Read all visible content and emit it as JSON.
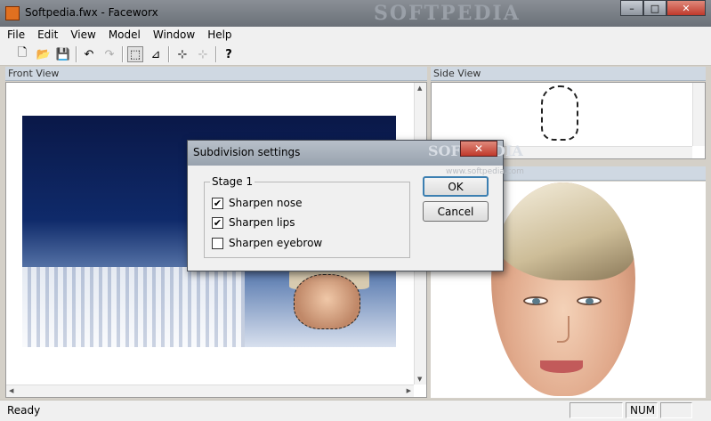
{
  "window": {
    "title": "Softpedia.fwx - Faceworx",
    "watermark": "SOFTPEDIA",
    "controls": {
      "minimize": "–",
      "maximize": "□",
      "close": "✕"
    }
  },
  "menu": [
    "File",
    "Edit",
    "View",
    "Model",
    "Window",
    "Help"
  ],
  "toolbar": {
    "icons": [
      "new-file-icon",
      "open-folder-icon",
      "save-icon",
      "undo-icon",
      "redo-icon",
      "select-frame-icon",
      "select-points-icon",
      "add-point-icon",
      "add-point-disabled-icon",
      "help-icon"
    ],
    "glyphs": {
      "new": "🗋",
      "open": "📂",
      "save": "💾",
      "undo": "↶",
      "redo": "↷",
      "frame": "⬚",
      "points": "⊿",
      "add": "⊹",
      "add2": "⊹",
      "help": "?"
    }
  },
  "panes": {
    "front_view": "Front View",
    "side_view": "Side View"
  },
  "dialog": {
    "title": "Subdivision settings",
    "watermark": "SOFTPEDIA",
    "watermark_sub": "www.softpedia.com",
    "group": "Stage 1",
    "options": [
      {
        "label": "Sharpen nose",
        "checked": true
      },
      {
        "label": "Sharpen lips",
        "checked": true
      },
      {
        "label": "Sharpen eyebrow",
        "checked": false
      }
    ],
    "ok": "OK",
    "cancel": "Cancel",
    "check_glyph": "✔"
  },
  "status": {
    "text": "Ready",
    "num": "NUM"
  }
}
